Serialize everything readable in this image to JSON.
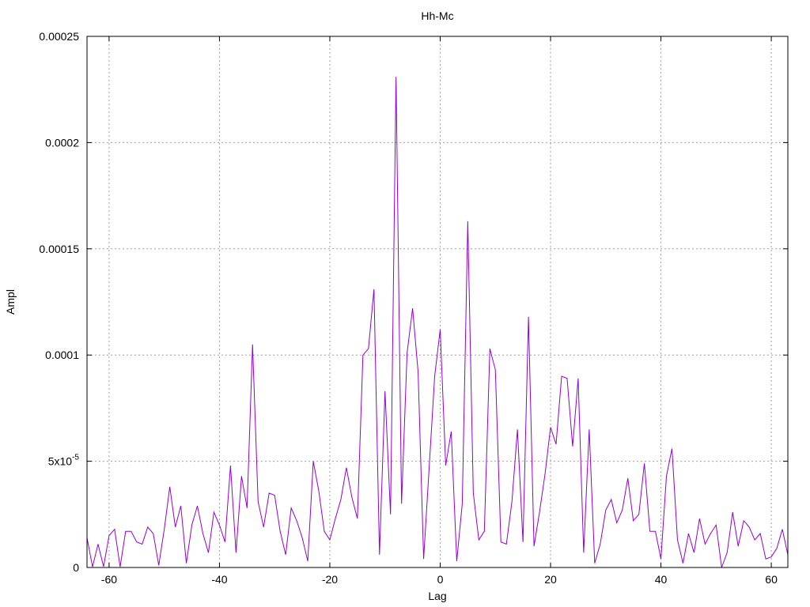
{
  "chart_data": {
    "type": "line",
    "title": "Hh-Mc",
    "xlabel": "Lag",
    "ylabel": "Ampl",
    "xlim": [
      -64,
      63
    ],
    "ylim": [
      0,
      0.00025
    ],
    "grid": true,
    "x_ticks": [
      -60,
      -40,
      -20,
      0,
      20,
      40,
      60
    ],
    "x_tick_labels": [
      "-60",
      "-40",
      "-20",
      "0",
      "20",
      "40",
      "60"
    ],
    "y_ticks": [
      0,
      5e-05,
      0.0001,
      0.00015,
      0.0002,
      0.00025
    ],
    "y_tick_labels": [
      {
        "base": "0",
        "exp": ""
      },
      {
        "base": "5x10",
        "exp": "-5"
      },
      {
        "base": "0.0001",
        "exp": ""
      },
      {
        "base": "0.00015",
        "exp": ""
      },
      {
        "base": "0.0002",
        "exp": ""
      },
      {
        "base": "0.00025",
        "exp": ""
      }
    ],
    "series": [
      {
        "color": "#9400d3",
        "x": [
          -64,
          -63,
          -62,
          -61,
          -60,
          -59,
          -58,
          -57,
          -56,
          -55,
          -54,
          -53,
          -52,
          -51,
          -50,
          -49,
          -48,
          -47,
          -46,
          -45,
          -44,
          -43,
          -42,
          -41,
          -40,
          -39,
          -38,
          -37,
          -36,
          -35,
          -34,
          -33,
          -32,
          -31,
          -30,
          -29,
          -28,
          -27,
          -26,
          -25,
          -24,
          -23,
          -22,
          -21,
          -20,
          -19,
          -18,
          -17,
          -16,
          -15,
          -14,
          -13,
          -12,
          -11,
          -10,
          -9,
          -8,
          -7,
          -6,
          -5,
          -4,
          -3,
          -2,
          -1,
          0,
          1,
          2,
          3,
          4,
          5,
          6,
          7,
          8,
          9,
          10,
          11,
          12,
          13,
          14,
          15,
          16,
          17,
          18,
          19,
          20,
          21,
          22,
          23,
          24,
          25,
          26,
          27,
          28,
          29,
          30,
          31,
          32,
          33,
          34,
          35,
          36,
          37,
          38,
          39,
          40,
          41,
          42,
          43,
          44,
          45,
          46,
          47,
          48,
          49,
          50,
          51,
          52,
          53,
          54,
          55,
          56,
          57,
          58,
          59,
          60,
          61,
          62,
          63
        ],
        "y": [
          1.4e-05,
          3e-07,
          1.1e-05,
          4e-07,
          1.5e-05,
          1.8e-05,
          3e-07,
          1.7e-05,
          1.7e-05,
          1.2e-05,
          1.1e-05,
          1.9e-05,
          1.6e-05,
          1e-06,
          1.8e-05,
          3.8e-05,
          1.9e-05,
          2.9e-05,
          2e-06,
          2e-05,
          2.9e-05,
          1.6e-05,
          7e-06,
          2.6e-05,
          2e-05,
          1.2e-05,
          4.8e-05,
          7e-06,
          4.3e-05,
          2.8e-05,
          0.000105,
          3.1e-05,
          1.9e-05,
          3.5e-05,
          3.4e-05,
          1.7e-05,
          6e-06,
          2.8e-05,
          2.2e-05,
          1.4e-05,
          3e-06,
          5e-05,
          3.6e-05,
          1.7e-05,
          1.3e-05,
          2.3e-05,
          3.2e-05,
          4.7e-05,
          3.3e-05,
          2.3e-05,
          0.0001,
          0.000103,
          0.000131,
          6e-06,
          8.3e-05,
          2.5e-05,
          0.000231,
          3e-05,
          0.000101,
          0.000122,
          9.2e-05,
          4e-06,
          4.7e-05,
          9e-05,
          0.000112,
          4.8e-05,
          6.4e-05,
          3e-06,
          3e-05,
          0.000163,
          3.5e-05,
          1.3e-05,
          1.7e-05,
          0.000103,
          9.3e-05,
          1.2e-05,
          1.1e-05,
          3.1e-05,
          6.5e-05,
          1.2e-05,
          0.000118,
          1e-05,
          2.6e-05,
          4.4e-05,
          6.6e-05,
          5.8e-05,
          9e-05,
          8.9e-05,
          5.7e-05,
          8.9e-05,
          7e-06,
          6.5e-05,
          2e-06,
          1.1e-05,
          2.7e-05,
          3.2e-05,
          2.1e-05,
          2.7e-05,
          4.2e-05,
          2.2e-05,
          2.5e-05,
          4.9e-05,
          1.7e-05,
          1.7e-05,
          4e-06,
          4.3e-05,
          5.6e-05,
          1.3e-05,
          2e-06,
          1.6e-05,
          7e-06,
          2.3e-05,
          1.1e-05,
          1.6e-05,
          2e-05,
          0.0,
          7e-06,
          2.6e-05,
          1e-05,
          2.2e-05,
          1.9e-05,
          1.3e-05,
          1.6e-05,
          4e-06,
          5e-06,
          9e-06,
          1.8e-05,
          6e-06
        ]
      }
    ]
  }
}
